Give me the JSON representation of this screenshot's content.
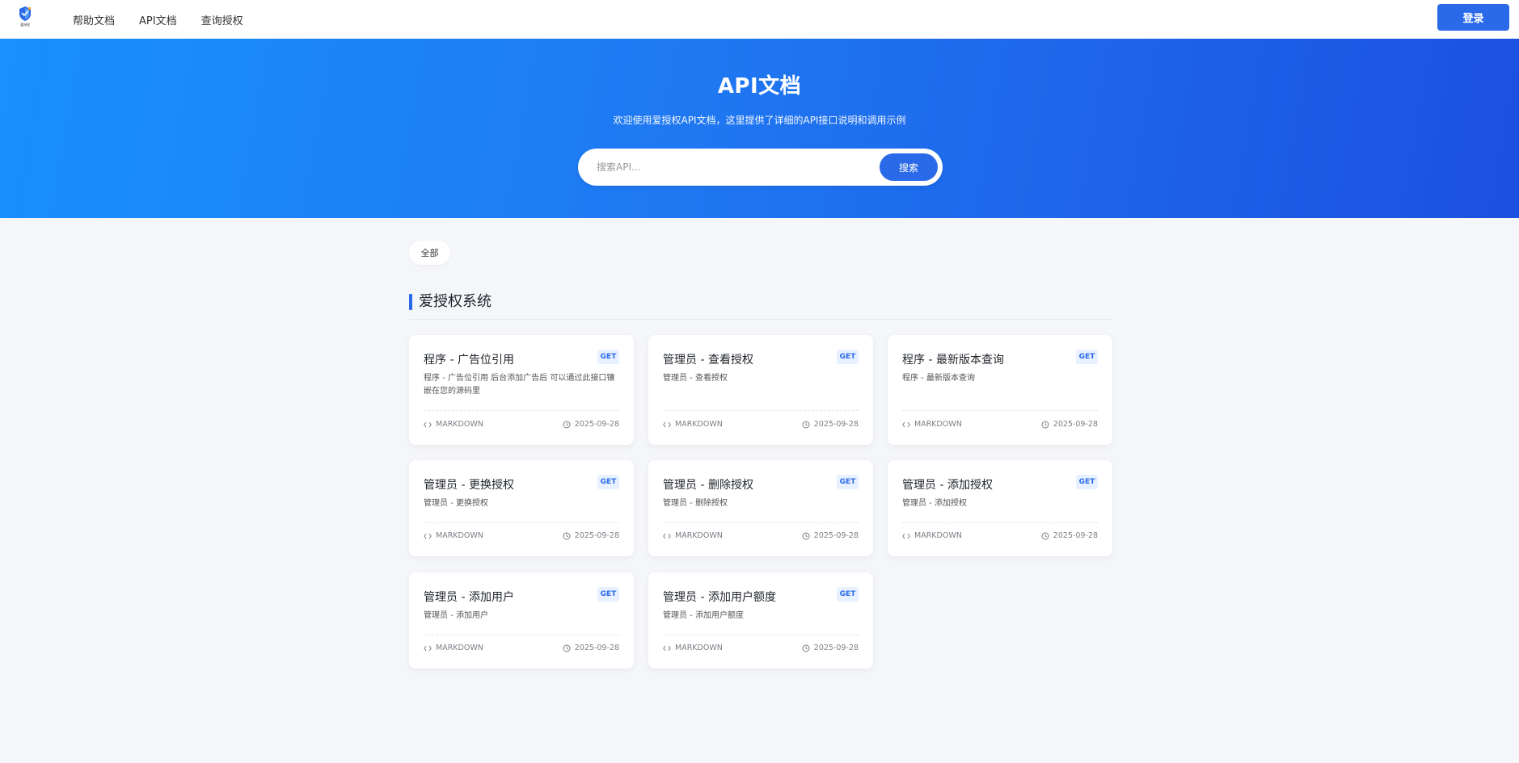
{
  "nav": {
    "logo_text": "爱授权",
    "links": [
      "帮助文档",
      "API文档",
      "查询授权"
    ],
    "login_label": "登录"
  },
  "hero": {
    "title": "API文档",
    "subtitle": "欢迎使用爱授权API文档，这里提供了详细的API接口说明和调用示例",
    "search_placeholder": "搜索API...",
    "search_button": "搜索"
  },
  "filter": {
    "all_label": "全部"
  },
  "section": {
    "title": "爱授权系统"
  },
  "colors": {
    "accent": "#2a6ae9",
    "badge_bg": "#e8f1ff",
    "hero_start": "#1890ff",
    "hero_end": "#1c50e0"
  },
  "cards": [
    {
      "title": "程序 - 广告位引用",
      "method": "GET",
      "desc": "程序 - 广告位引用 后台添加广告后 可以通过此接口镶嵌在您的源码里",
      "type": "MARKDOWN",
      "date": "2025-09-28"
    },
    {
      "title": "管理员 - 查看授权",
      "method": "GET",
      "desc": "管理员 - 查看授权",
      "type": "MARKDOWN",
      "date": "2025-09-28"
    },
    {
      "title": "程序 - 最新版本查询",
      "method": "GET",
      "desc": "程序 - 最新版本查询",
      "type": "MARKDOWN",
      "date": "2025-09-28"
    },
    {
      "title": "管理员 - 更换授权",
      "method": "GET",
      "desc": "管理员 - 更换授权",
      "type": "MARKDOWN",
      "date": "2025-09-28"
    },
    {
      "title": "管理员 - 删除授权",
      "method": "GET",
      "desc": "管理员 - 删除授权",
      "type": "MARKDOWN",
      "date": "2025-09-28"
    },
    {
      "title": "管理员 - 添加授权",
      "method": "GET",
      "desc": "管理员 - 添加授权",
      "type": "MARKDOWN",
      "date": "2025-09-28"
    },
    {
      "title": "管理员 - 添加用户",
      "method": "GET",
      "desc": "管理员 - 添加用户",
      "type": "MARKDOWN",
      "date": "2025-09-28"
    },
    {
      "title": "管理员 - 添加用户额度",
      "method": "GET",
      "desc": "管理员 - 添加用户额度",
      "type": "MARKDOWN",
      "date": "2025-09-28"
    }
  ]
}
